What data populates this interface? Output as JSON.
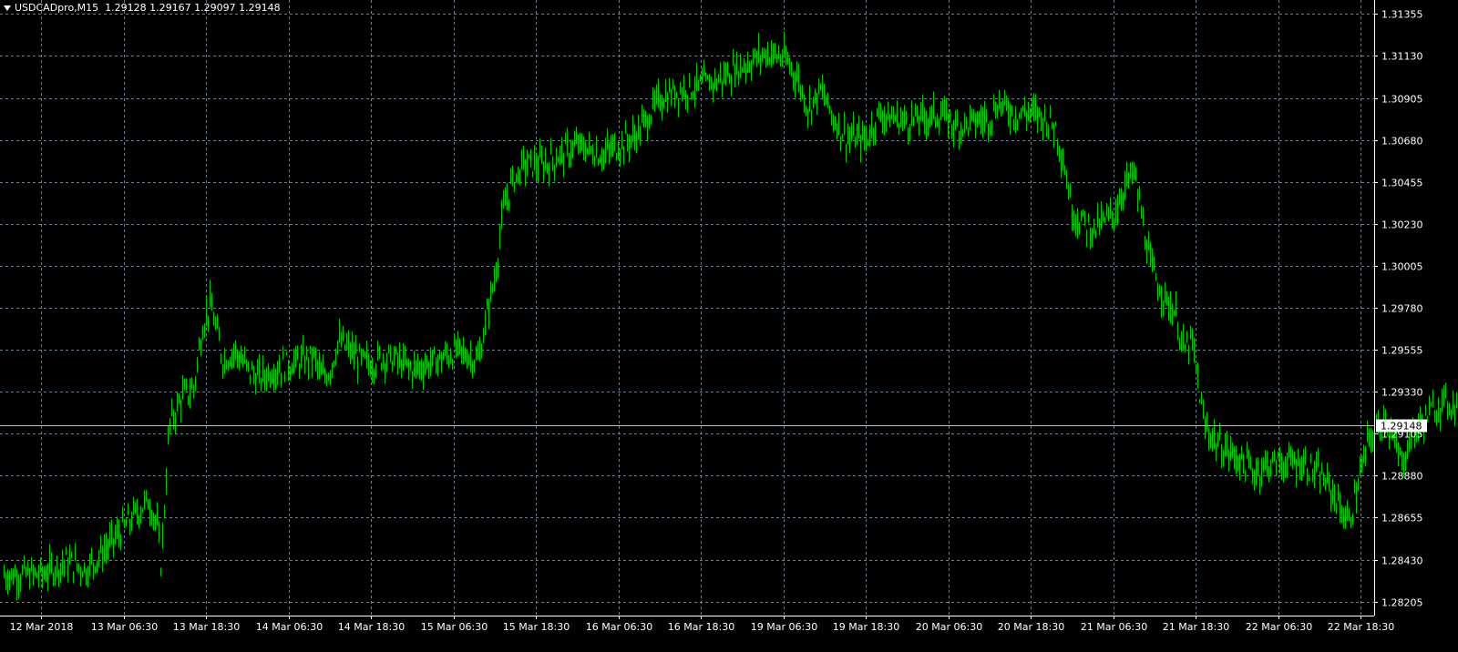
{
  "header": {
    "symbol": "USDCADpro,M15",
    "ohlc": "1.29128 1.29167 1.29097 1.29148"
  },
  "colors": {
    "background": "#000000",
    "grid": "#6f7d8c",
    "candles": "#00c800",
    "axis_text": "#ffffff",
    "current_price_line": "#c0c0c0"
  },
  "icons": {
    "dropdown": "triangle-down-icon"
  },
  "chart_data": {
    "type": "line",
    "title": "",
    "xlabel": "",
    "ylabel": "",
    "grid": true,
    "ylim": [
      1.2813,
      1.3143
    ],
    "y_ticks": [
      "1.31355",
      "1.31130",
      "1.30905",
      "1.30680",
      "1.30455",
      "1.30230",
      "1.30005",
      "1.29780",
      "1.29555",
      "1.29330",
      "1.29105",
      "1.28880",
      "1.28655",
      "1.28430",
      "1.28205"
    ],
    "x_ticks": [
      "12 Mar 2018",
      "13 Mar 06:30",
      "13 Mar 18:30",
      "14 Mar 06:30",
      "14 Mar 18:30",
      "15 Mar 06:30",
      "15 Mar 18:30",
      "16 Mar 06:30",
      "16 Mar 18:30",
      "19 Mar 06:30",
      "19 Mar 18:30",
      "20 Mar 06:30",
      "20 Mar 18:30",
      "21 Mar 06:30",
      "21 Mar 18:30",
      "22 Mar 06:30",
      "22 Mar 18:30"
    ],
    "current_price": "1.29148",
    "series": [
      {
        "points": [
          [
            0,
            1.2835
          ],
          [
            0.3,
            1.2842
          ],
          [
            0.55,
            1.2838
          ],
          [
            0.8,
            1.285
          ],
          [
            1.0,
            1.286
          ],
          [
            1.15,
            1.2868
          ],
          [
            1.3,
            1.2875
          ],
          [
            1.4,
            1.2862
          ],
          [
            1.45,
            1.284
          ],
          [
            1.55,
            1.2915
          ],
          [
            1.7,
            1.293
          ],
          [
            1.85,
            1.2935
          ],
          [
            1.95,
            1.2968
          ],
          [
            2.05,
            1.298
          ],
          [
            2.1,
            1.297
          ],
          [
            2.2,
            1.295
          ],
          [
            2.35,
            1.2955
          ],
          [
            2.5,
            1.2945
          ],
          [
            2.65,
            1.294
          ],
          [
            2.8,
            1.2945
          ],
          [
            3.0,
            1.2948
          ],
          [
            3.2,
            1.295
          ],
          [
            3.3,
            1.2952
          ],
          [
            3.4,
            1.294
          ],
          [
            3.5,
            1.2945
          ],
          [
            3.6,
            1.296
          ],
          [
            3.75,
            1.2955
          ],
          [
            3.85,
            1.295
          ],
          [
            4.0,
            1.2948
          ],
          [
            4.15,
            1.2952
          ],
          [
            4.3,
            1.295
          ],
          [
            4.5,
            1.2945
          ],
          [
            4.8,
            1.295
          ],
          [
            5.05,
            1.2955
          ],
          [
            5.3,
            1.295
          ],
          [
            5.45,
            1.2985
          ],
          [
            5.5,
            1.2995
          ],
          [
            5.6,
            1.303
          ],
          [
            5.7,
            1.3045
          ],
          [
            5.85,
            1.3055
          ],
          [
            6.1,
            1.3055
          ],
          [
            6.3,
            1.306
          ],
          [
            6.5,
            1.3065
          ],
          [
            6.8,
            1.306
          ],
          [
            7.0,
            1.3065
          ],
          [
            7.2,
            1.307
          ],
          [
            7.35,
            1.308
          ],
          [
            7.5,
            1.309
          ],
          [
            7.75,
            1.3095
          ],
          [
            8.0,
            1.3097
          ],
          [
            8.2,
            1.31
          ],
          [
            8.5,
            1.3108
          ],
          [
            8.8,
            1.3115
          ],
          [
            9.0,
            1.3112
          ],
          [
            9.15,
            1.3103
          ],
          [
            9.3,
            1.3085
          ],
          [
            9.45,
            1.3095
          ],
          [
            9.6,
            1.308
          ],
          [
            9.75,
            1.307
          ],
          [
            10.0,
            1.3068
          ],
          [
            10.15,
            1.3082
          ],
          [
            10.3,
            1.308
          ],
          [
            10.5,
            1.3078
          ],
          [
            10.7,
            1.308
          ],
          [
            10.9,
            1.3082
          ],
          [
            11.1,
            1.3075
          ],
          [
            11.3,
            1.3078
          ],
          [
            11.5,
            1.308
          ],
          [
            11.6,
            1.3088
          ],
          [
            11.8,
            1.3082
          ],
          [
            12.0,
            1.3083
          ],
          [
            12.15,
            1.308
          ],
          [
            12.3,
            1.3075
          ],
          [
            12.4,
            1.3055
          ],
          [
            12.5,
            1.303
          ],
          [
            12.6,
            1.3025
          ],
          [
            12.75,
            1.302
          ],
          [
            13.0,
            1.3028
          ],
          [
            13.15,
            1.3045
          ],
          [
            13.25,
            1.305
          ],
          [
            13.35,
            1.3025
          ],
          [
            13.45,
            1.3
          ],
          [
            13.6,
            1.2985
          ],
          [
            13.75,
            1.2975
          ],
          [
            13.85,
            1.2955
          ],
          [
            13.95,
            1.296
          ],
          [
            14.05,
            1.293
          ],
          [
            14.1,
            1.2915
          ],
          [
            14.3,
            1.2903
          ],
          [
            14.5,
            1.2898
          ],
          [
            14.7,
            1.289
          ],
          [
            14.9,
            1.2895
          ],
          [
            15.1,
            1.2895
          ],
          [
            15.3,
            1.2895
          ],
          [
            15.5,
            1.2888
          ],
          [
            15.65,
            1.288
          ],
          [
            15.85,
            1.2862
          ],
          [
            16.0,
            1.289
          ],
          [
            16.1,
            1.2908
          ],
          [
            16.3,
            1.292
          ],
          [
            16.4,
            1.2905
          ],
          [
            16.5,
            1.2895
          ],
          [
            16.6,
            1.2908
          ],
          [
            16.8,
            1.292
          ],
          [
            17.0,
            1.2928
          ],
          [
            17.2,
            1.2925
          ],
          [
            17.3,
            1.2915
          ]
        ]
      }
    ]
  }
}
